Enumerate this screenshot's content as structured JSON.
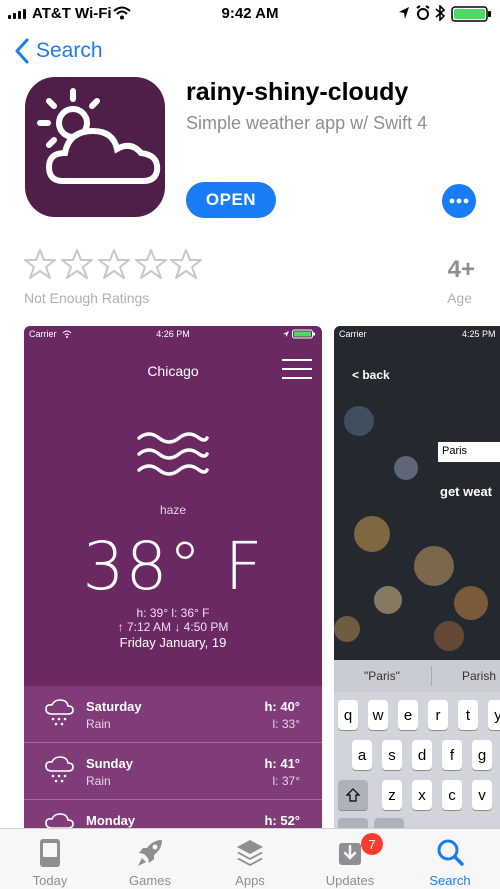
{
  "status_bar": {
    "carrier": "AT&T Wi-Fi",
    "time": "9:42 AM"
  },
  "nav": {
    "back_label": "Search"
  },
  "app": {
    "name": "rainy-shiny-cloudy",
    "subtitle": "Simple weather app w/ Swift 4",
    "open_label": "OPEN",
    "more_label": "•••",
    "brand_color": "#1a7cf5",
    "icon_color": "#4f1f4a"
  },
  "ratings": {
    "stars_filled": 0,
    "stars_total": 5,
    "label": "Not Enough Ratings"
  },
  "age": {
    "value": "4+",
    "label": "Age"
  },
  "screenshots": {
    "first": {
      "carrier": "Carrier",
      "time": "4:26 PM",
      "city": "Chicago",
      "condition": "haze",
      "temperature": "38° F",
      "hilo": "h: 39°   l: 36° F",
      "sun": "↑ 7:12 AM   ↓ 4:50 PM",
      "date": "Friday January, 19",
      "forecast": [
        {
          "day": "Saturday",
          "desc": "Rain",
          "hi": "h: 40°",
          "lo": "l: 33°"
        },
        {
          "day": "Sunday",
          "desc": "Rain",
          "hi": "h: 41°",
          "lo": "l: 37°"
        },
        {
          "day": "Monday",
          "desc": "",
          "hi": "h: 52°",
          "lo": ""
        }
      ]
    },
    "second": {
      "carrier": "Carrier",
      "time": "4:25 PM",
      "back_label": "< back",
      "input_value": "Paris",
      "button_label": "get weat",
      "suggestions": [
        "\"Paris\"",
        "Parish"
      ],
      "keys_row1": [
        "q",
        "w",
        "e",
        "r",
        "t",
        "y"
      ],
      "keys_row2": [
        "a",
        "s",
        "d",
        "f",
        "g",
        "h"
      ],
      "keys_row3": [
        "z",
        "x",
        "c",
        "v",
        "b"
      ]
    }
  },
  "tab_bar": {
    "tabs": [
      {
        "label": "Today",
        "icon": "today-icon"
      },
      {
        "label": "Games",
        "icon": "rocket-icon"
      },
      {
        "label": "Apps",
        "icon": "layers-icon"
      },
      {
        "label": "Updates",
        "icon": "download-icon"
      },
      {
        "label": "Search",
        "icon": "search-icon"
      }
    ],
    "updates_badge": "7",
    "active": "Search"
  }
}
